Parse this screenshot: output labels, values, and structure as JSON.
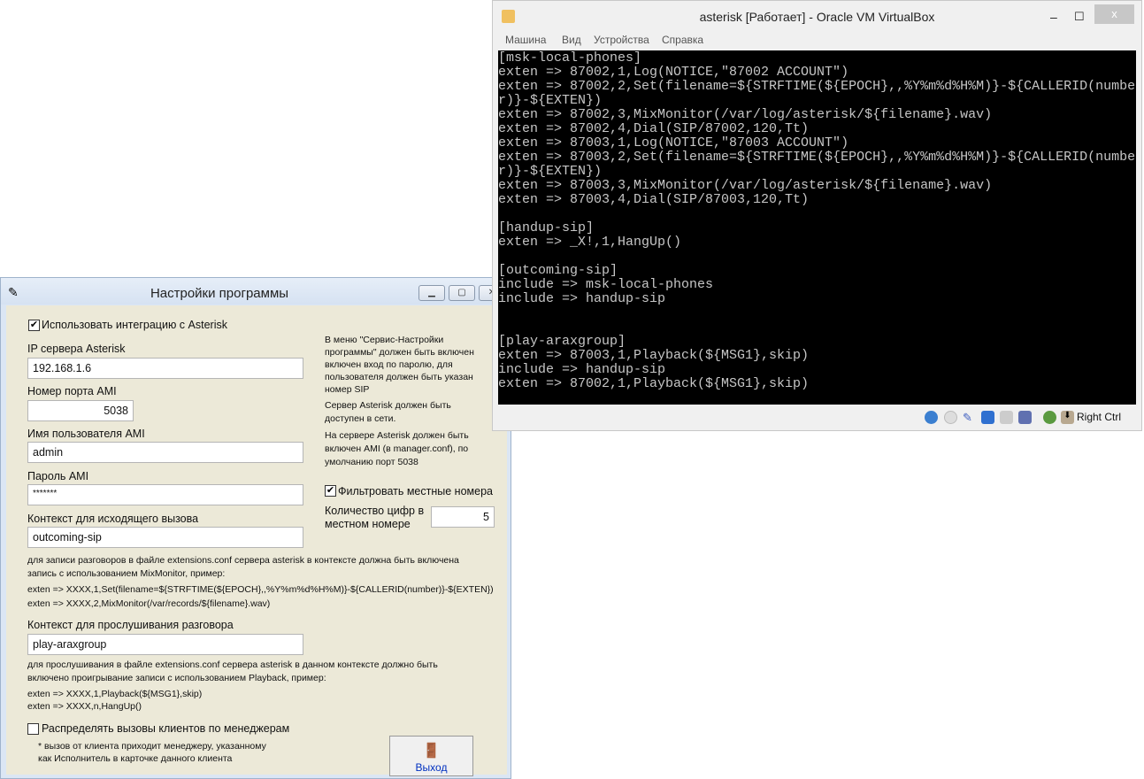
{
  "settings": {
    "title": "Настройки программы",
    "use_asterisk": {
      "label": "Использовать интеграцию с Asterisk",
      "checked": true
    },
    "ip_label": "IP сервера Asterisk",
    "ip_value": "192.168.1.6",
    "port_label": "Номер порта AMI",
    "port_value": "5038",
    "user_label": "Имя пользователя AMI",
    "user_value": "admin",
    "pass_label": "Пароль AMI",
    "pass_value": "*******",
    "out_label": "Контекст для исходящего вызова",
    "out_value": "outcoming-sip",
    "rec_note": [
      "для записи разговоров в файле extensions.conf сервера asterisk в контексте должна быть включена",
      "запись с использованием MixMonitor, пример:"
    ],
    "rec_code": [
      "exten =>  XXXX,1,Set(filename=${STRFTIME(${EPOCH},,%Y%m%d%H%M)}-${CALLERID(number)}-${EXTEN})",
      "exten =>  XXXX,2,MixMonitor(/var/records/${filename}.wav)"
    ],
    "play_label": "Контекст для прослушивания разговора",
    "play_value": "play-araxgroup",
    "play_note": [
      "для прослушивания в файле extensions.conf сервера asterisk в данном контексте должно быть",
      "включено проигрывание записи с использованием Playback, пример:"
    ],
    "play_code": [
      "exten =>  XXXX,1,Playback(${MSG1},skip)",
      "exten =>  XXXX,n,HangUp()"
    ],
    "distribute": {
      "label": "Распределять вызовы клиентов по менеджерам",
      "checked": false
    },
    "distribute_note": [
      "* вызов от клиента приходит менеджеру, указанному",
      "как Исполнитель в карточке данного клиента"
    ],
    "info1": [
      "В меню \"Сервис-Настройки",
      "программы\" должен быть включен",
      "включен вход по паролю, для",
      "пользователя должен быть указан",
      "номер SIP"
    ],
    "info2": [
      "Сервер Asterisk должен быть",
      "доступен в сети."
    ],
    "info3": [
      "На сервере Asterisk должен быть",
      "включен AMI (в manager.conf), по",
      "умолчанию порт 5038"
    ],
    "filter": {
      "label": "Фильтровать местные номера",
      "checked": true
    },
    "digits_label": [
      "Количество цифр в",
      "местном номере"
    ],
    "digits_value": "5",
    "exit_label": "Выход"
  },
  "vbox": {
    "title": "asterisk [Работает] - Oracle VM VirtualBox",
    "menu": [
      "Машина",
      "Вид",
      "Устройства",
      "Справка"
    ],
    "terminal": [
      "[msk-local-phones]",
      "exten => 87002,1,Log(NOTICE,\"87002 ACCOUNT\")",
      "exten => 87002,2,Set(filename=${STRFTIME(${EPOCH},,%Y%m%d%H%M)}-${CALLERID(numbe",
      "r)}-${EXTEN})",
      "exten => 87002,3,MixMonitor(/var/log/asterisk/${filename}.wav)",
      "exten => 87002,4,Dial(SIP/87002,120,Tt)",
      "exten => 87003,1,Log(NOTICE,\"87003 ACCOUNT\")",
      "exten => 87003,2,Set(filename=${STRFTIME(${EPOCH},,%Y%m%d%H%M)}-${CALLERID(numbe",
      "r)}-${EXTEN})",
      "exten => 87003,3,MixMonitor(/var/log/asterisk/${filename}.wav)",
      "exten => 87003,4,Dial(SIP/87003,120,Tt)",
      "",
      "[handup-sip]",
      "exten => _X!,1,HangUp()",
      "",
      "[outcoming-sip]",
      "include => msk-local-phones",
      "include => handup-sip",
      "",
      "",
      "[play-araxgroup]",
      "exten => 87003,1,Playback(${MSG1},skip)",
      "include => handup-sip",
      "exten => 87002,1,Playback(${MSG1},skip)"
    ],
    "host_key": "Right Ctrl"
  }
}
